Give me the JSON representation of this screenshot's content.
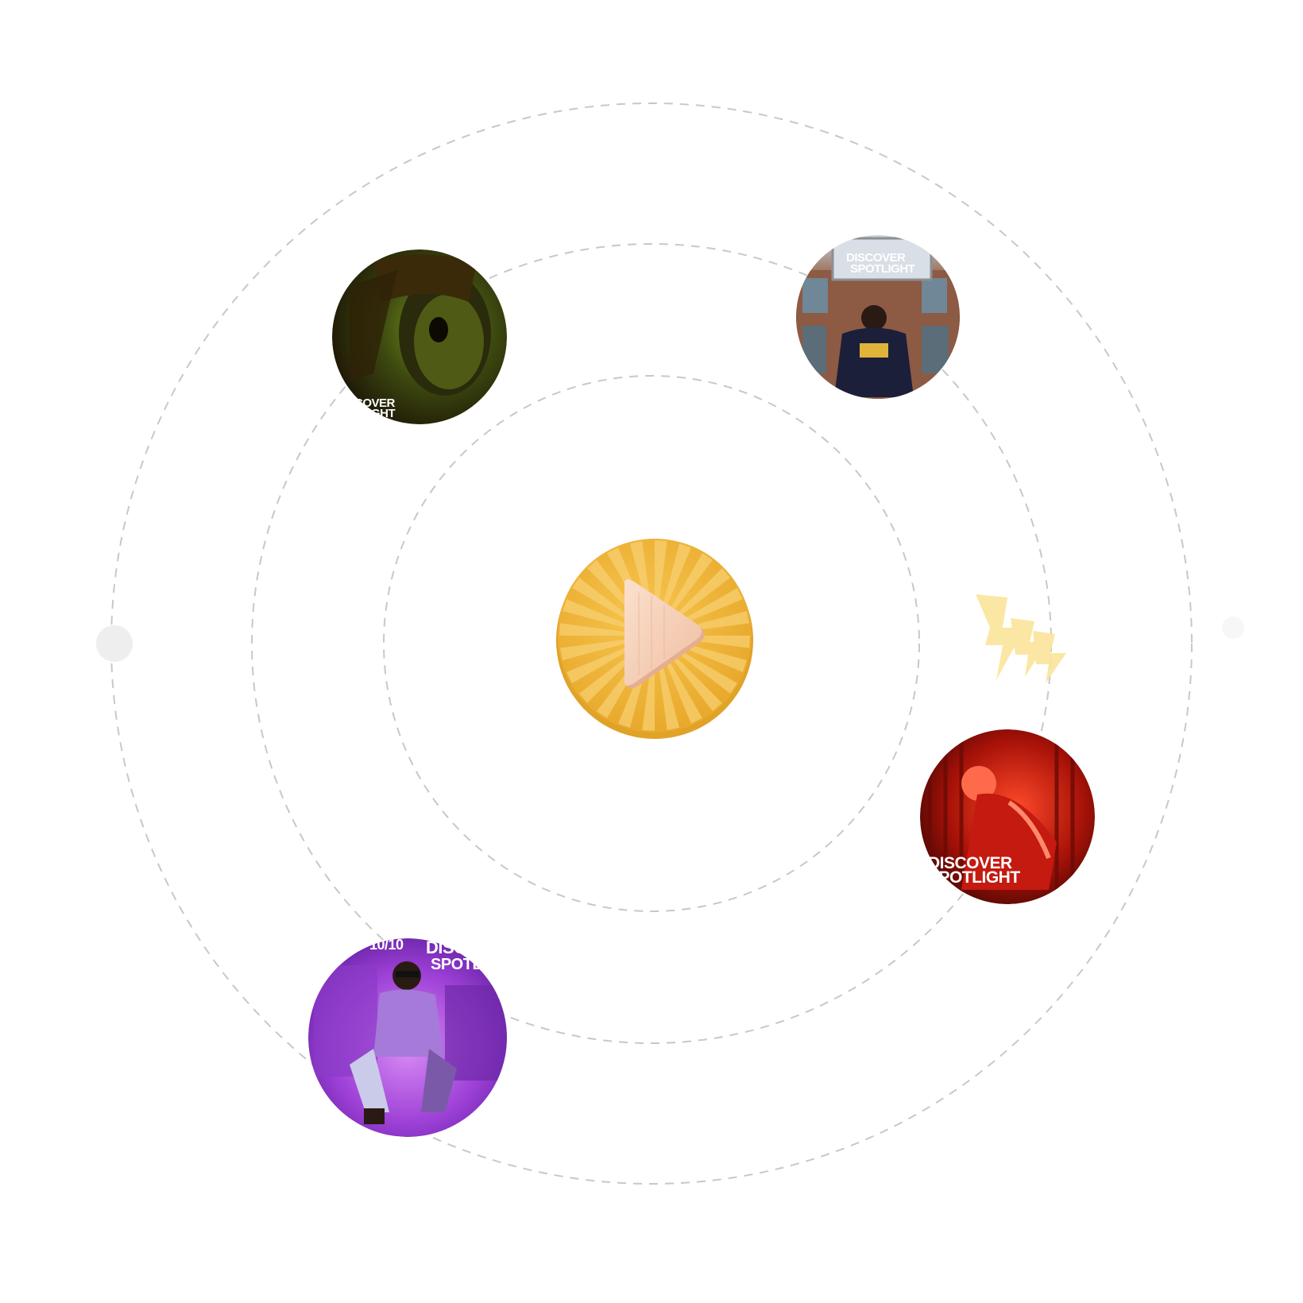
{
  "center_button": {
    "icon": "play-icon",
    "colors": {
      "disc": "#f2b83a",
      "rays": "#f7cf70",
      "triangle": "#f6cfb6"
    }
  },
  "covers": [
    {
      "id": "cover-green",
      "icon": "artist-portrait-green",
      "lines": [
        "COVER",
        "TLIGHT"
      ],
      "colors": {
        "base": "#2a2108",
        "glow": "#5f7f0f"
      }
    },
    {
      "id": "cover-building",
      "icon": "artist-portrait-building",
      "lines": [
        "DISCOVER",
        "SPOTLIGHT"
      ],
      "colors": {
        "base": "#6c4a3a",
        "sky": "#b9c7d4"
      }
    },
    {
      "id": "cover-red",
      "icon": "artist-portrait-red",
      "lines": [
        "DISCOVER",
        "SPOTLIGHT"
      ],
      "colors": {
        "base": "#3a0505",
        "glow": "#e02a1a"
      }
    },
    {
      "id": "cover-purple",
      "icon": "artist-portrait-purple",
      "lines": [
        "10/10",
        "DISCO",
        "SPOTLI"
      ],
      "colors": {
        "base": "#7a2fc0",
        "glow": "#c873f0"
      }
    }
  ],
  "decorations": {
    "lightning": "lightning-icon",
    "lightning_color": "#fbe49a",
    "dot_color": "#eeeeee"
  }
}
